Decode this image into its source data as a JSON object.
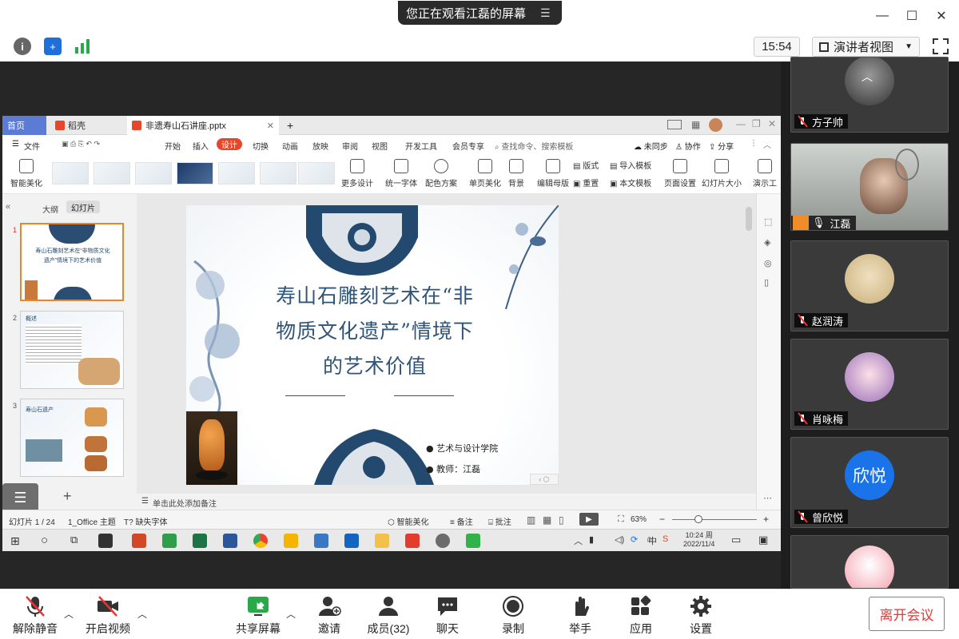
{
  "meeting": {
    "share_banner": "您正在观看江磊的屏幕",
    "clock": "15:54",
    "view_mode": "演讲者视图"
  },
  "wps": {
    "tabs": {
      "home": "首页",
      "wps": "稻壳",
      "file": "非遗寿山石讲座.pptx"
    },
    "menu": [
      "文件",
      "开始",
      "插入",
      "设计",
      "切换",
      "动画",
      "放映",
      "审阅",
      "视图",
      "开发工具",
      "会员专享"
    ],
    "active_menu": "设计",
    "search_placeholder": "查找命令、搜索模板",
    "sync": "未同步",
    "collab": "协作",
    "share": "分享",
    "ribbon": {
      "smart_beautify": "智能美化",
      "more_design": "更多设计",
      "unify_font": "统一字体",
      "color_scheme": "配色方案",
      "single_page": "单页美化",
      "background": "背景",
      "edit_master": "编辑母版",
      "layout": "版式",
      "reset": "重置",
      "import_template": "导入模板",
      "this_template": "本文模板",
      "page_setup": "页面设置",
      "slide_size": "幻灯片大小",
      "present": "演示工"
    },
    "panel_tabs": {
      "outline": "大纲",
      "slides": "幻灯片"
    },
    "thumb1_title": "寿山石雕刻艺术在“非物质文化遗产”情境下的艺术价值",
    "thumb2_title": "概述",
    "thumb3_title": "寿山石遗产",
    "slide_numbers": [
      "1",
      "2",
      "3"
    ],
    "add_slide": "+",
    "slide": {
      "title_line1": "寿山石雕刻艺术在“非",
      "title_line2": "物质文化遗产”情境下",
      "title_line3": "的艺术价值",
      "bullet1": "艺术与设计学院",
      "bullet2": "教师：江磊"
    },
    "notes_placeholder": "单击此处添加备注",
    "status": {
      "slide_count": "幻灯片 1 / 24",
      "theme": "1_Office 主题",
      "missing_font": "缺失字体",
      "smart_beautify": "智能美化",
      "notes": "备注",
      "comments": "批注",
      "zoom": "63%",
      "zoom_level": 0.63
    },
    "taskbar": {
      "time": "10:24 周",
      "date": "2022/11/4",
      "ime": "中"
    }
  },
  "participants": [
    {
      "name": "方子帅",
      "muted": true
    },
    {
      "name": "江磊",
      "muted": false
    },
    {
      "name": "赵润涛",
      "muted": true
    },
    {
      "name": "肖咏梅",
      "muted": true
    },
    {
      "name": "曾欣悦",
      "muted": true,
      "avatar_text": "欣悦",
      "avatar_color": "#1a73e8"
    }
  ],
  "bottombar": {
    "unmute": "解除静音",
    "start_video": "开启视频",
    "share_screen": "共享屏幕",
    "invite": "邀请",
    "members": "成员(32)",
    "chat": "聊天",
    "record": "录制",
    "raise_hand": "举手",
    "apps": "应用",
    "settings": "设置",
    "leave": "离开会议"
  },
  "colors": {
    "accent_red": "#e8462a",
    "slide_blue": "#234a6e",
    "leave_red": "#e33"
  }
}
